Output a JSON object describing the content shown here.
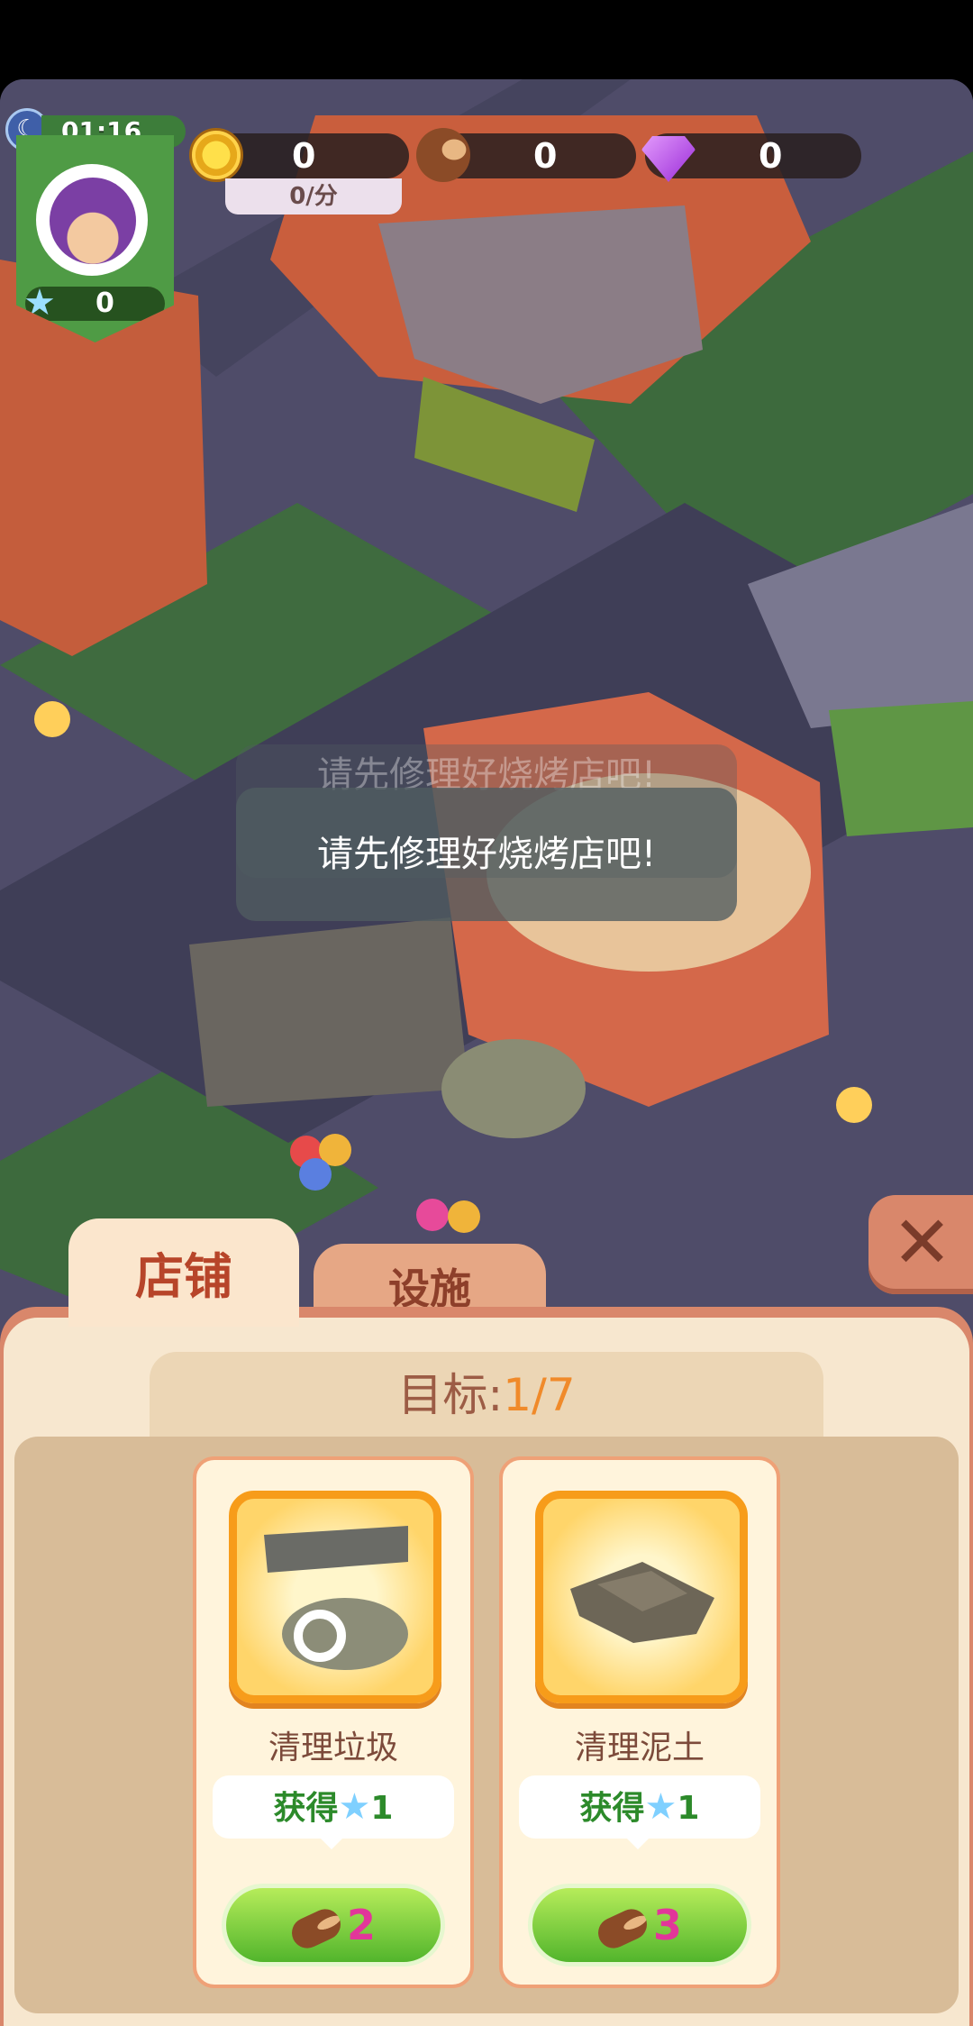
{
  "hud": {
    "timer": "01:16",
    "player_stars": "0",
    "coins": "0",
    "coin_rate": "0/分",
    "wood": "0",
    "gems": "0"
  },
  "toast": {
    "message": "请先修理好烧烤店吧!"
  },
  "tabs": [
    {
      "label": "店铺",
      "active": true
    },
    {
      "label": "设施",
      "active": false
    }
  ],
  "goal": {
    "label": "目标:",
    "progress": "1/7"
  },
  "tasks": [
    {
      "name": "清理垃圾",
      "reward_label": "获得",
      "reward_value": "1",
      "cost": "2"
    },
    {
      "name": "清理泥土",
      "reward_label": "获得",
      "reward_value": "1",
      "cost": "3"
    }
  ],
  "close_symbol": "✕",
  "colors": {
    "accent": "#f08a2a",
    "tab_text": "#b7452a",
    "button_green": "#52b52c",
    "cost_pink": "#e2369a"
  }
}
